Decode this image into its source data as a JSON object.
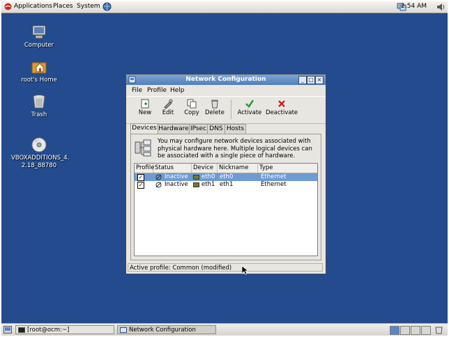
{
  "top_panel": {
    "menus": [
      "Applications",
      "Places",
      "System"
    ],
    "clock": "2:54 AM"
  },
  "desktop": {
    "icons": [
      {
        "label": "Computer",
        "icon": "computer-icon"
      },
      {
        "label": "root's Home",
        "icon": "home-folder-icon"
      },
      {
        "label": "Trash",
        "icon": "trash-icon"
      },
      {
        "label_line1": "VBOXADDITIONS_4.",
        "label_line2": "2.18_88780",
        "icon": "cdrom-icon"
      }
    ]
  },
  "window": {
    "title": "Network Configuration",
    "menu": [
      "File",
      "Profile",
      "Help"
    ],
    "toolbar": {
      "new": "New",
      "edit": "Edit",
      "copy": "Copy",
      "delete": "Delete",
      "activate": "Activate",
      "deactivate": "Deactivate"
    },
    "tabs": [
      "Devices",
      "Hardware",
      "IPsec",
      "DNS",
      "Hosts"
    ],
    "active_tab": "Devices",
    "info_text": "You may configure network devices associated with physical hardware here.  Multiple logical devices can be associated with a single piece of hardware.",
    "columns": [
      "Profile",
      "Status",
      "Device",
      "Nickname",
      "Type"
    ],
    "rows": [
      {
        "profile": true,
        "status": "Inactive",
        "device": "eth0",
        "nickname": "eth0",
        "type": "Ethernet",
        "selected": true
      },
      {
        "profile": true,
        "status": "Inactive",
        "device": "eth1",
        "nickname": "eth1",
        "type": "Ethernet",
        "selected": false
      }
    ],
    "status": "Active profile: Common (modified)"
  },
  "bottom_panel": {
    "tasks": [
      "[root@ocm:~]",
      "Network Configuration"
    ],
    "workspaces": 4,
    "active_workspace": 1
  },
  "colors": {
    "desktop": "#234b8e",
    "titlebar": "#5f8bc4",
    "selection": "#6f9bd3"
  }
}
